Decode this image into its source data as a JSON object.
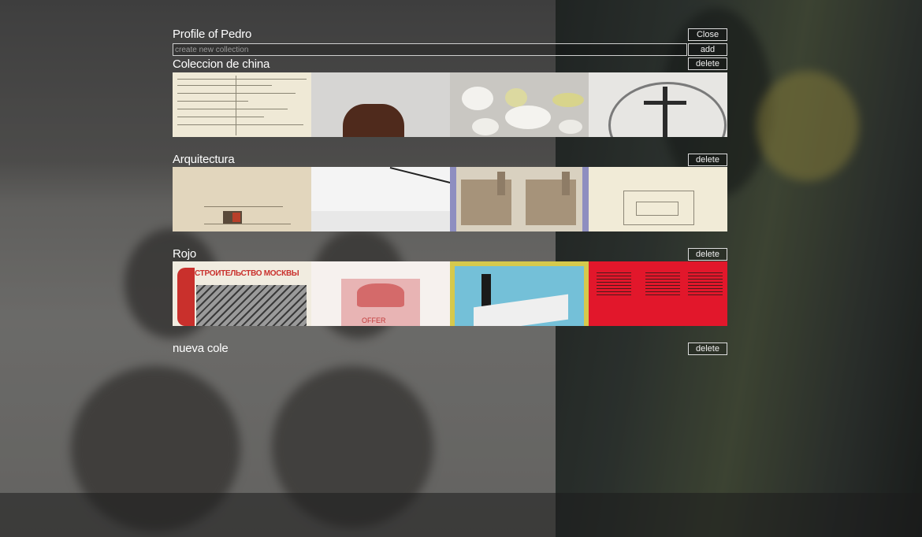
{
  "profile": {
    "title": "Profile of Pedro",
    "close_label": "Close",
    "new_collection_placeholder": "create new collection",
    "add_label": "add"
  },
  "collections": [
    {
      "name": "Coleccion de china",
      "delete_label": "delete",
      "thumbnails": [
        "document-card",
        "brown-pot",
        "tea-set",
        "crucifix-plate"
      ]
    },
    {
      "name": "Arquitectura",
      "delete_label": "delete",
      "thumbnails": [
        "architectural-sketch",
        "white-interior",
        "cathedral-stereograph",
        "floor-plan"
      ]
    },
    {
      "name": "Rojo",
      "delete_label": "delete",
      "thumbnails": [
        "moscow-construction-poster",
        "red-print-offer",
        "industrial-poster",
        "red-typographic-poster"
      ]
    },
    {
      "name": "nueva cole",
      "delete_label": "delete",
      "thumbnails": []
    }
  ],
  "thumb_text": {
    "moscow_headline": "СТРОИТЕЛЬСТВО МОСКВЫ",
    "offer_label": "OFFER"
  },
  "colors": {
    "button_border": "#dcdcdc",
    "overlay": "rgba(0,0,0,0.30)",
    "red_poster": "#e2172b"
  }
}
